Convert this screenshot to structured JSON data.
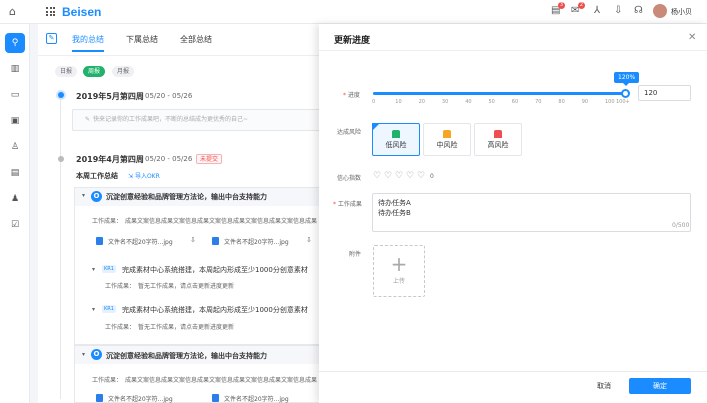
{
  "app": {
    "logo": "Beisen",
    "user_name": "杨小贝",
    "badges": [
      "3",
      "2"
    ]
  },
  "main": {
    "tabs": [
      {
        "label": "我的总结"
      },
      {
        "label": "下属总结"
      },
      {
        "label": "全部总结"
      }
    ],
    "period_pills": [
      "日报",
      "周报",
      "月报"
    ],
    "week1": {
      "title": "2019年5月第四周",
      "date": "05/20 - 05/26",
      "placeholder": "快来记录你的工作成果吧，不断的总结成为更优秀的自己~"
    },
    "week2": {
      "title": "2019年4月第四周",
      "date": "05/20 - 05/26",
      "tag": "未提交",
      "section_title": "本周工作总结",
      "import_label": "导入OKR",
      "objective1": {
        "badge": "O",
        "title": "沉淀创意经验和品牌管理方法论，输出中台支持能力",
        "result_label": "工作成果：",
        "result_text": "成果文案信息成果文案信息成果文案信息成果文案信息成果文案信息成果",
        "files": [
          "文件名不超20字符...jpg",
          "文件名不超20字符...jpg"
        ],
        "krs": [
          {
            "tag": "KR1",
            "title": "完成素材中心系统搭建，本周起内形成至少1000分创意素材",
            "result_label": "工作成果：",
            "result_text": "暂无工作成果，请点击更新进度更新"
          },
          {
            "tag": "KR1",
            "title": "完成素材中心系统搭建，本周起内形成至少1000分创意素材",
            "result_label": "工作成果：",
            "result_text": "暂无工作成果，请点击更新进度更新"
          }
        ]
      },
      "objective2": {
        "badge": "O",
        "title": "沉淀创意经验和品牌管理方法论，输出中台支持能力",
        "result_label": "工作成果：",
        "result_text": "成果文案信息成果文案信息成果文案信息成果文案信息成果文案信息成果",
        "files": [
          "文件名不超20字符...jpg",
          "文件名不超20字符...jpg"
        ]
      }
    }
  },
  "drawer": {
    "title": "更新进度",
    "progress_label": "进度",
    "progress_tip": "120%",
    "progress_value": "120",
    "progress_fraction": 1.0,
    "ticks": [
      "0",
      "10",
      "20",
      "30",
      "40",
      "50",
      "60",
      "70",
      "80",
      "90",
      "100"
    ],
    "tick_end": "100+",
    "risk_label": "达成风险",
    "risk_options": [
      {
        "label": "低风险",
        "color": "#20b26b",
        "selected": true
      },
      {
        "label": "中风险",
        "color": "#f5a623",
        "selected": false
      },
      {
        "label": "高风险",
        "color": "#f04e4e",
        "selected": false
      }
    ],
    "confidence_label": "信心指数",
    "confidence_value": "0",
    "result_label": "工作成果",
    "result_lines": [
      "待办任务A",
      "待办任务B"
    ],
    "counter": "0/500",
    "attach_label": "附件",
    "upload_label": "上传",
    "cancel_label": "取消",
    "ok_label": "确定"
  }
}
